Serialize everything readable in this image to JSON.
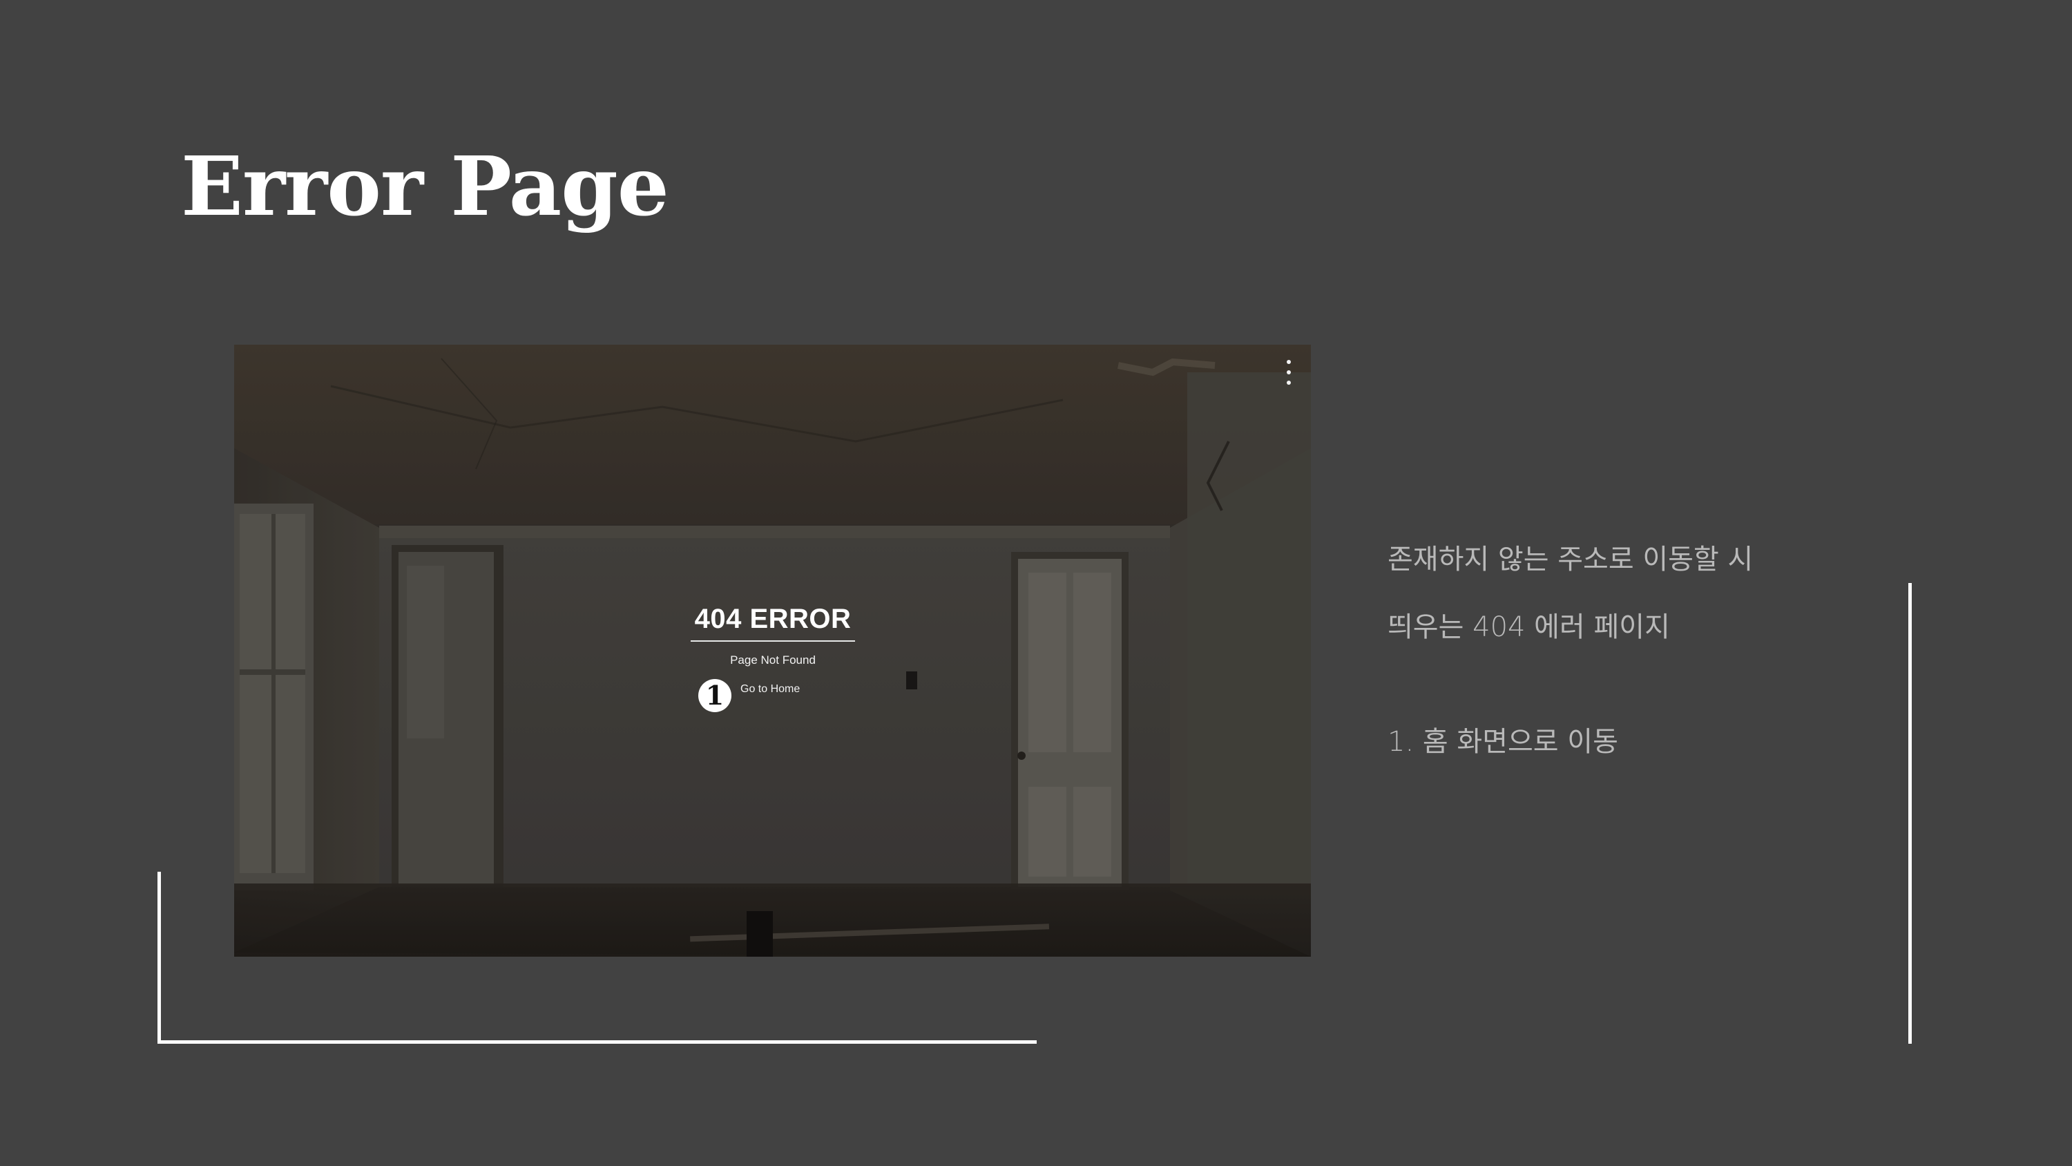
{
  "slide": {
    "title": "Error Page"
  },
  "preview": {
    "error_heading": "404 ERROR",
    "error_subtitle": "Page Not Found",
    "callout_number": "1",
    "home_link": "Go to Home",
    "menu_icon": "kebab-menu-icon"
  },
  "description": {
    "line1": "존재하지 않는 주소로 이동할 시",
    "line2": "띄우는 404 에러 페이지",
    "item1": "1. 홈 화면으로 이동"
  },
  "colors": {
    "background": "#424242",
    "title": "#ffffff",
    "description_text": "#b9b9b9",
    "accent_lines": "#ffffff"
  }
}
